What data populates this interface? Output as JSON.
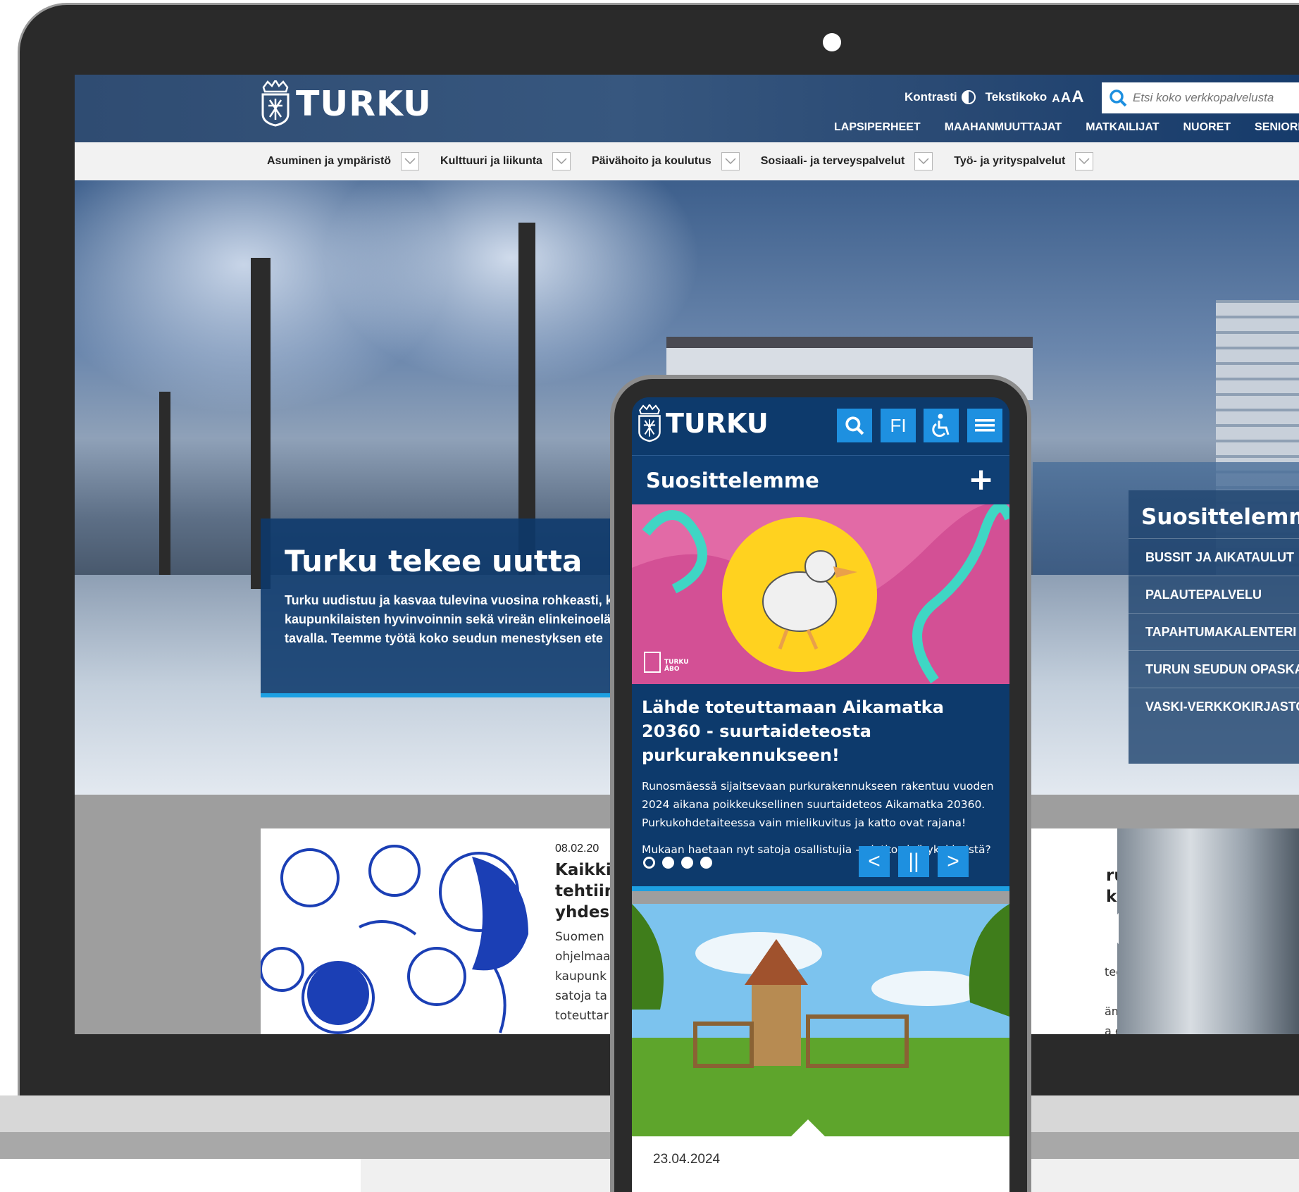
{
  "header": {
    "logo_text": "TURKU",
    "contrast_label": "Kontrasti",
    "textsize_label": "Tekstikoko",
    "textsize_options": [
      "A",
      "A",
      "A"
    ],
    "search_placeholder": "Etsi koko verkkopalvelusta",
    "audience_links": [
      "LAPSIPERHEET",
      "MAAHANMUUTTAJAT",
      "MATKAILIJAT",
      "NUORET",
      "SENIORI"
    ]
  },
  "main_nav": [
    "Asuminen ja ympäristö",
    "Kulttuuri ja liikunta",
    "Päivähoito ja koulutus",
    "Sosiaali- ja terveyspalvelut",
    "Työ- ja yrityspalvelut"
  ],
  "hero": {
    "title": "Turku tekee uutta",
    "text_lines": [
      "Turku uudistuu ja kasvaa tulevina vuosina rohkeasti, k",
      "kaupunkilaisten hyvinvoinnin sekä vireän elinkeinoelä",
      "tavalla. Teemme työtä koko seudun menestyksen ete"
    ]
  },
  "recommend": {
    "title": "Suosittelemme",
    "links": [
      "BUSSIT JA AIKATAULUT",
      "PALAUTEPALVELU",
      "TAPAHTUMAKALENTERI",
      "TURUN SEUDUN OPASKA",
      "VASKI-VERKKOKIRJASTO"
    ]
  },
  "news_left": {
    "date": "08.02.20",
    "title_lines": [
      "Kaikkie",
      "tehtiin",
      "yhdess"
    ],
    "body_lines": [
      "Suomen",
      "ohjelmaa",
      "kaupunk",
      "satoja ta",
      "toteuttar"
    ]
  },
  "news_right": {
    "title_lines": [
      "run",
      "ksen"
    ],
    "body_lines": [
      "teena on",
      "",
      "ämys- ja",
      "a esitellään"
    ]
  },
  "mobile": {
    "logo_text": "TURKU",
    "lang_label": "FI",
    "suggest_label": "Suosittelemme",
    "slide_badge": "TURKU ÅBO",
    "slide_title": "Lähde toteuttamaan Aikamatka 20360 - suurtaideteosta purkurakennukseen!",
    "slide_text": "Runosmäessä sijaitsevaan purkurakennukseen rakentuu vuoden 2024 aikana poikkeuksellinen suurtaideteos Aikamatka 20360. Purkukohdetaiteessa vain mielikuvitus ja katto ovat rajana!",
    "slide_text2": "Mukaan haetaan nyt satoja osallistujia – oletko sinä yksi heistä?",
    "prev_symbol": "<",
    "pause_symbol": "||",
    "next_symbol": ">",
    "card_date": "23.04.2024"
  },
  "colors": {
    "brand_blue": "#0d3a6c",
    "accent_blue": "#1e90e0",
    "accent_line": "#1da0e2"
  }
}
